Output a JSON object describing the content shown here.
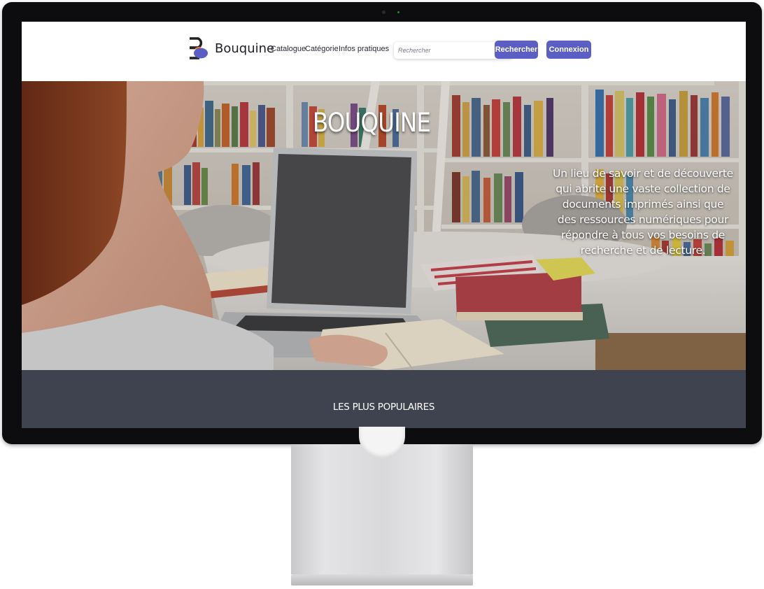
{
  "brand": {
    "name": "Bouquine",
    "logo_icon": "bouquine-logo-icon"
  },
  "nav": {
    "links": [
      "Catalogue",
      "Catégorie",
      "Infos pratiques"
    ]
  },
  "search": {
    "placeholder": "Rechercher",
    "value": "",
    "button_label": "Rechercher"
  },
  "login": {
    "label": "Connexion"
  },
  "hero": {
    "title": "BOUQUINE",
    "description": "Un lieu de savoir et de découverte qui abrite une vaste collection de documents imprimés ainsi que des ressources numériques pour répondre à tous vos besoins de recherche et de lecture."
  },
  "popular": {
    "title": "LES PLUS POPULAIRES"
  },
  "colors": {
    "accent": "#5b5fc4",
    "dark_band": "#3f4350",
    "monitor_bezel": "#0d0d0f"
  }
}
